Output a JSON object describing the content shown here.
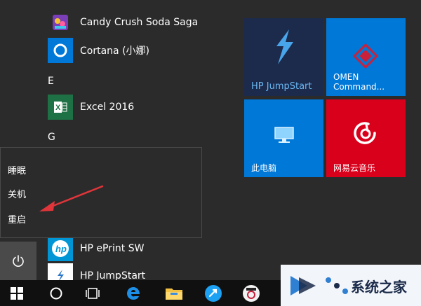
{
  "apps": [
    {
      "label": "Candy Crush Soda Saga",
      "icon": "candy-crush-icon"
    },
    {
      "label": "Cortana (小娜)",
      "icon": "cortana-icon"
    },
    {
      "label": "Excel 2016",
      "icon": "excel-icon"
    },
    {
      "label": "HP ePrint SW",
      "icon": "hp-logo-icon"
    },
    {
      "label": "HP JumpStart",
      "icon": "hp-jumpstart-icon"
    }
  ],
  "sections": {
    "e": "E",
    "g": "G"
  },
  "power_menu": {
    "sleep": "睡眠",
    "shutdown": "关机",
    "restart": "重启"
  },
  "tiles": [
    {
      "label": "HP JumpStart",
      "color": "#1c2a4c"
    },
    {
      "label": "OMEN\nCommand...",
      "color": "#0078d7"
    },
    {
      "label": "此电脑",
      "color": "#0078d7"
    },
    {
      "label": "网易云音乐",
      "color": "#d9001b"
    }
  ],
  "taskbar": [
    "windows-start-icon",
    "cortana-search-icon",
    "task-view-icon",
    "edge-icon",
    "file-explorer-icon",
    "sync-app-icon",
    "browser-app-icon"
  ],
  "watermark": {
    "text": "系统之家"
  },
  "colors": {
    "accent": "#0078d7",
    "arrow": "#e0353a",
    "netease": "#d9001b",
    "excel": "#1e7145"
  }
}
